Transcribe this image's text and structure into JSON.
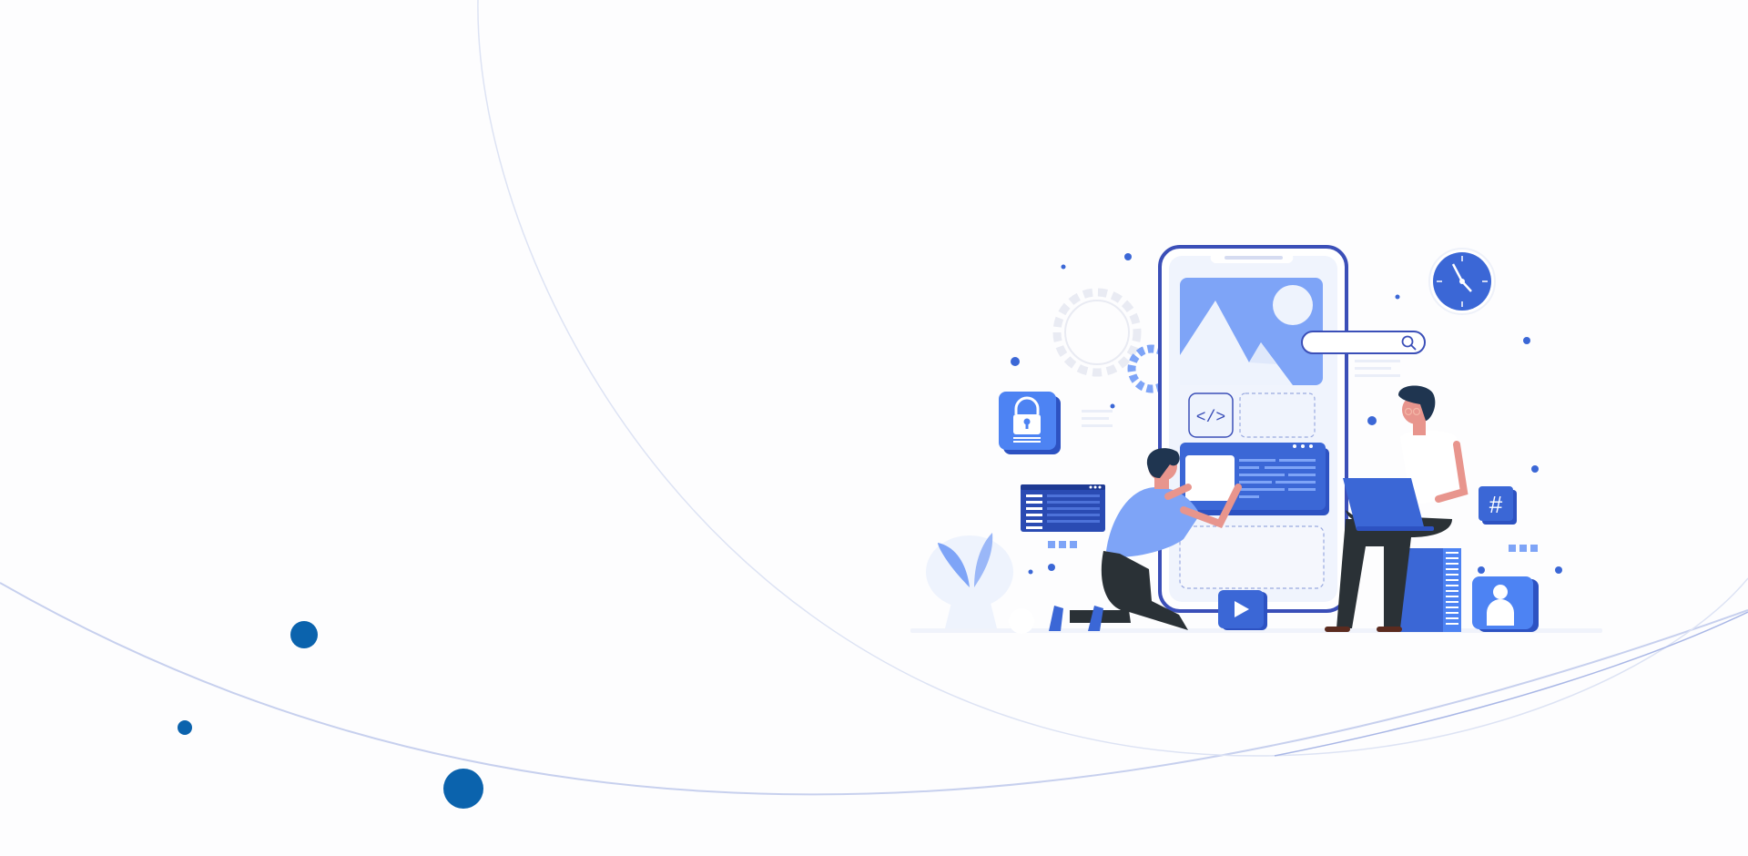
{
  "scene": {
    "background_color": "#fdfdfe",
    "accent_dark": "#0b63ad",
    "accent_blue": "#3b67d6",
    "accent_light": "#7ea4f7",
    "curve_color": "#c9d3ef",
    "icons": [
      "lock-icon",
      "code-icon",
      "search-icon",
      "clock-icon",
      "hashtag-icon",
      "user-icon",
      "play-icon",
      "gear-icon",
      "image-icon"
    ]
  }
}
